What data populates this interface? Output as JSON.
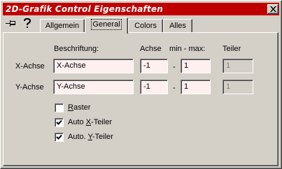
{
  "window": {
    "title": "2D-Grafik Control Eigenschaften",
    "close_label": "close"
  },
  "toolbar": {
    "pin_icon": "pushpin-icon",
    "help_icon": "help-question-icon"
  },
  "tabs": [
    {
      "label": "Allgemein",
      "active": false
    },
    {
      "label": "General",
      "active": true
    },
    {
      "label": "Colors",
      "active": false
    },
    {
      "label": "Alles",
      "active": false
    }
  ],
  "headers": {
    "beschriftung": "Beschriftung:",
    "achse": "Achse",
    "minmax": "min - max:",
    "teiler": "Teiler"
  },
  "rows": {
    "x": {
      "label": "X-Achse",
      "beschriftung": "X-Achse",
      "min": "-1",
      "dash": "-",
      "max": "1",
      "teiler": "1"
    },
    "y": {
      "label": "Y-Achse",
      "beschriftung": "Y-Achse",
      "min": "-1",
      "dash": "-",
      "max": "1",
      "teiler": "1"
    }
  },
  "options": {
    "raster": {
      "label_underlined": "R",
      "label_rest": "aster",
      "checked": false
    },
    "auto_x": {
      "label_prefix": "Auto ",
      "label_underlined": "X",
      "label_rest": "-Teiler",
      "checked": true
    },
    "auto_y": {
      "label_prefix": "Auto. ",
      "label_underlined": "Y",
      "label_rest": "-Teiler",
      "checked": true
    }
  },
  "colors": {
    "titlebar": "#c00000",
    "field_bg": "#fff0f0",
    "face": "#d4d0c8"
  }
}
